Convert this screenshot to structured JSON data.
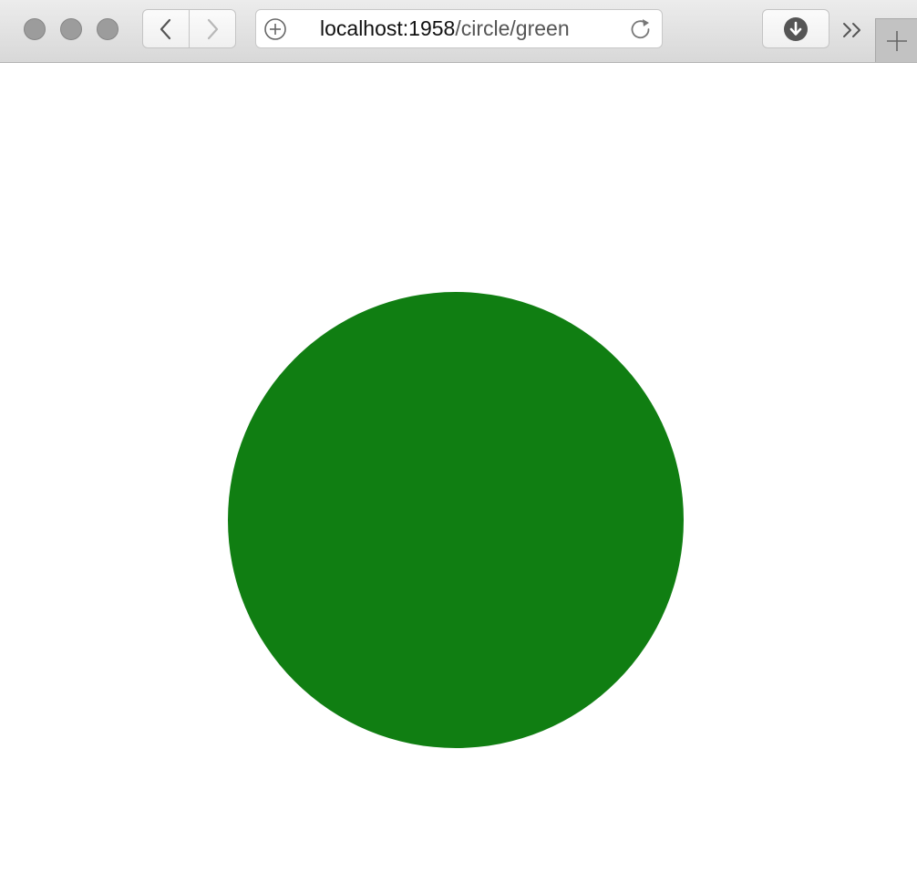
{
  "browser": {
    "address": {
      "host": "localhost:1958",
      "path": "/circle/green"
    },
    "icons": {
      "back": "chevron-left-icon",
      "forward": "chevron-right-icon",
      "add": "plus-circle-icon",
      "reload": "reload-icon",
      "download": "download-icon",
      "overflow": "double-chevron-right-icon",
      "new_tab": "plus-icon"
    }
  },
  "page": {
    "circle": {
      "color": "#107e12"
    }
  },
  "colors": {
    "toolbar": "#dcdcdc",
    "traffic_light": "#9c9c9c",
    "background": "#ffffff"
  }
}
